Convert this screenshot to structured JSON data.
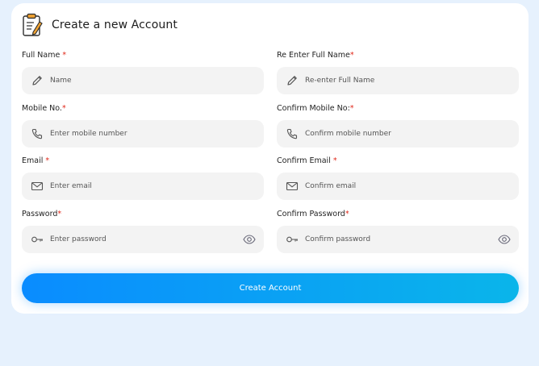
{
  "header": {
    "title": "Create a new Account"
  },
  "fields": {
    "full_name": {
      "label": "Full Name",
      "required": "*",
      "placeholder": "Name",
      "icon": "pencil-icon"
    },
    "re_full_name": {
      "label": "Re Enter Full Name",
      "required": "*",
      "placeholder": "Re-enter Full Name",
      "icon": "pencil-icon"
    },
    "mobile": {
      "label": "Mobile No.",
      "required": "*",
      "placeholder": "Enter mobile number",
      "icon": "phone-icon"
    },
    "confirm_mobile": {
      "label": "Confirm Mobile No:",
      "required": "*",
      "placeholder": "Confirm mobile number",
      "icon": "phone-icon"
    },
    "email": {
      "label": "Email",
      "required": "*",
      "placeholder": "Enter email",
      "icon": "mail-icon"
    },
    "confirm_email": {
      "label": "Confirm Email",
      "required": "*",
      "placeholder": "Confirm email",
      "icon": "mail-icon"
    },
    "password": {
      "label": "Password",
      "required": "*",
      "placeholder": "Enter password",
      "icon": "key-icon"
    },
    "confirm_password": {
      "label": "Confirm Password",
      "required": "*",
      "placeholder": "Confirm password",
      "icon": "key-icon"
    }
  },
  "submit": {
    "label": "Create Account"
  },
  "colors": {
    "background": "#e6f1fd",
    "accent_start": "#0a8cff",
    "accent_end": "#0ab5ea",
    "required": "#e0281a",
    "input_bg": "#f3f3f3"
  }
}
